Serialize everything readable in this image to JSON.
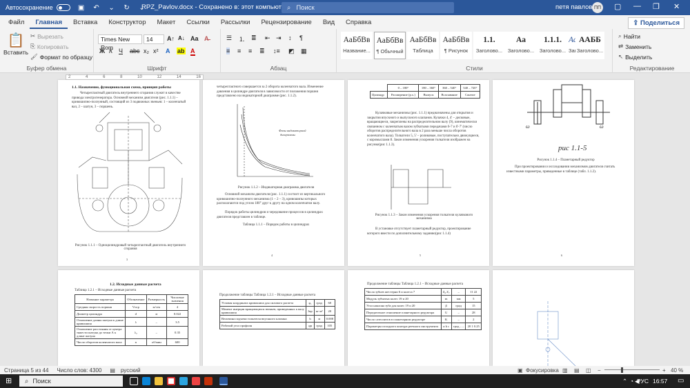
{
  "titlebar": {
    "autosave_label": "Автосохранение",
    "autosave_state": "Откл.",
    "document_title": "RPZ_Pavlov.docx - Сохранено в: этот компьютер",
    "search_placeholder": "Поиск",
    "user_name": "петя павлов",
    "user_initials": "ПП"
  },
  "menu": {
    "tabs": [
      "Файл",
      "Главная",
      "Вставка",
      "Конструктор",
      "Макет",
      "Ссылки",
      "Рассылки",
      "Рецензирование",
      "Вид",
      "Справка"
    ],
    "active_tab": "Главная",
    "share_label": "Поделиться"
  },
  "ribbon": {
    "clipboard": {
      "paste_label": "Вставить",
      "cut_label": "Вырезать",
      "copy_label": "Копировать",
      "format_painter_label": "Формат по образцу",
      "group_label": "Буфер обмена"
    },
    "font": {
      "font_name": "Times New Rom",
      "font_size": "14",
      "group_label": "Шрифт"
    },
    "paragraph": {
      "group_label": "Абзац"
    },
    "styles": {
      "items": [
        {
          "sample": "АаБбВв",
          "name": "Название..."
        },
        {
          "sample": "АаБбВв",
          "name": "¶ Обычный"
        },
        {
          "sample": "АаБбВв",
          "name": "Таблица"
        },
        {
          "sample": "АаБбВв",
          "name": "¶ Рисунок"
        },
        {
          "sample": "1.1.",
          "name": "Заголово..."
        },
        {
          "sample": "Аа",
          "name": "Заголово..."
        },
        {
          "sample": "1.1.1.",
          "name": "Заголово..."
        },
        {
          "sample": "АаБбВ",
          "name": "Заголово..."
        },
        {
          "sample": "ААББ",
          "name": "Заголово..."
        }
      ],
      "group_label": "Стили"
    },
    "editing": {
      "find_label": "Найти",
      "replace_label": "Заменить",
      "select_label": "Выделить",
      "group_label": "Редактирование"
    }
  },
  "ruler": {
    "ticks": [
      "2",
      "4",
      "6",
      "8",
      "10",
      "12",
      "14",
      "16"
    ]
  },
  "pages": {
    "p1": {
      "heading": "1.1.     Назначение, функциональная схема, принцип работы",
      "body": "Четырехтактный двигатель внутреннего сгорания служит в качестве привода электрогенератора. Основной механизм двигателя (рис. 1.1.1) – кривошипно-ползунный, состоящий из 3 подвижных звеньев: 1 – коленчатый вал, 2 – шатун, 3 – поршень.",
      "caption": "Рисунок 1.1.1 – Одноцилиндровый четырехтактный двигатель внутреннего сгорания",
      "page_num": "3"
    },
    "p2": {
      "top_text": "четырехтактного совершается за 2 оборота коленчатого вала. Изменение давления в цилиндре двигателя в зависимости от положения поршня представлено на индикаторной диаграмме (рис. 1.1.2).",
      "caption": "Рисунок 1.1.2 – Индикаторная диаграмма двигателя",
      "body": "Основной механизм двигателя (рис. 1.1.1) состоит из вертикального кривошипно-ползунного механизма (1 – 2 – 3), кривошипы которых располагаются под углом 180° друг к другу на одном коленчатом валу.",
      "body2": "Порядок работы цилиндров и чередование процессов в цилиндрах двигателя представлен в таблице.",
      "table_caption": "Таблица 1.1.1 – Порядок работы в цилиндрах",
      "page_num": "4"
    },
    "p3": {
      "table_header": [
        "0 – 180°",
        "180 – 360°",
        "360 – 540°",
        "540 – 720°"
      ],
      "table_row": [
        "Цилиндр",
        "Расширение (р.х.)",
        "Выпуск",
        "Всасывание",
        "Сжатие"
      ],
      "body": "Кулачковые механизмы (рис. 1.1.1) предназначены для открытия и закрытия впускного и выпускного клапанов. Кулачки 4, 4' – дисковые, вращающиеся, закреплены на распределительном валу (9), кинематически связанном с коленчатым валом зубчатыми передачами 6-7 и 6'-7' (число оборотов распределительного вала в 2 раза меньше числа оборотов коленчатого вала). Толкатели 5, 5' – роликовые, поступательно движущиеся, с коромыслами 8. Закон изменения ускорения толкателя изображен на рисунке(рис 1.1.3).",
      "caption": "Рисунок 1.1.3 – Закон изменения ускорения толкателя кулачкового механизма",
      "body2": "В установке отсутствует планетарный редуктор, проектирование которого ввести по дополнительному заданию(рис 1.1.4)",
      "page_num": "5"
    },
    "p4": {
      "sketch_label": "рис 1.1-5",
      "caption": "Рисунок 1.1.4 – Планетарный редуктор",
      "body": "При проектировании и исследовании механизмов двигателя считать известными параметры, приведенные в таблице (табл. 1.1.2).",
      "page_num": "6"
    },
    "p5": {
      "heading": "1.2.     Исходные данные расчета",
      "table_caption": "Таблица 1.2.1 – Исходные данные расчета",
      "headers": [
        "Название параметра",
        "Обозначение",
        "Размерность",
        "Числовые значения"
      ],
      "rows": [
        [
          "Средняя скорость поршня",
          "Vпср",
          "м/сек",
          "4"
        ],
        [
          "Диаметр цилиндра",
          "d",
          "м",
          "0.022"
        ],
        [
          "Отношение длины шатуна к длине кривошипа",
          "λ",
          "–",
          "3.5"
        ],
        [
          "Отношение расстояния от центра тяжести шатуна до точки А к длине шатуна",
          "λ₂",
          "–",
          "0.35"
        ],
        [
          "Число оборотов коленчатого вала",
          "n",
          "об/мин",
          "600"
        ]
      ]
    },
    "p6": {
      "table_caption": "Продолжение таблицы Таблица 1.2.1 – Исходные данные расчета",
      "rows": [
        [
          "Угловая координата кривошипа для силового расчета",
          "φ₁",
          "град",
          "60"
        ],
        [
          "Момент инерции вращающихся звеньев, приведенных к валу кривошипа",
          "Iпр",
          "кг·м²",
          "20"
        ],
        [
          "Величина подъема толкателя впускного клапана",
          "h",
          "м",
          "0.008"
        ],
        [
          "Рабочий угол профиля",
          "φр",
          "град",
          "105"
        ]
      ]
    },
    "p7": {
      "table_caption": "Продолжение таблицы Таблица 1.2.1 – Исходные данные расчета",
      "rows": [
        [
          "Числа зубьев шестерни 6 и колеса 7",
          "Z₆ Z₇",
          "–",
          "11 22"
        ],
        [
          "Модуль зубчатых колес 19 и 20",
          "m",
          "мм",
          "5"
        ],
        [
          "Угол наклона зуба для колес 19 и 20",
          "β",
          "град",
          "15"
        ],
        [
          "Передаточное отношение планетарного редуктора",
          "U",
          "–",
          "28"
        ],
        [
          "Число сателлитов в планетарном редукторе",
          "K",
          "–",
          "2"
        ],
        [
          "Параметры исходного контура реечного инструмента",
          "α h c",
          "град – –",
          "20 1 0.25"
        ]
      ]
    }
  },
  "statusbar": {
    "page_info": "Страница 5 из 44",
    "word_count": "Число слов: 4300",
    "language": "русский",
    "focus_label": "Фокусировка",
    "zoom": "40 %"
  },
  "taskbar": {
    "search_placeholder": "Поиск",
    "lang": "РУС",
    "time": "16:57"
  }
}
